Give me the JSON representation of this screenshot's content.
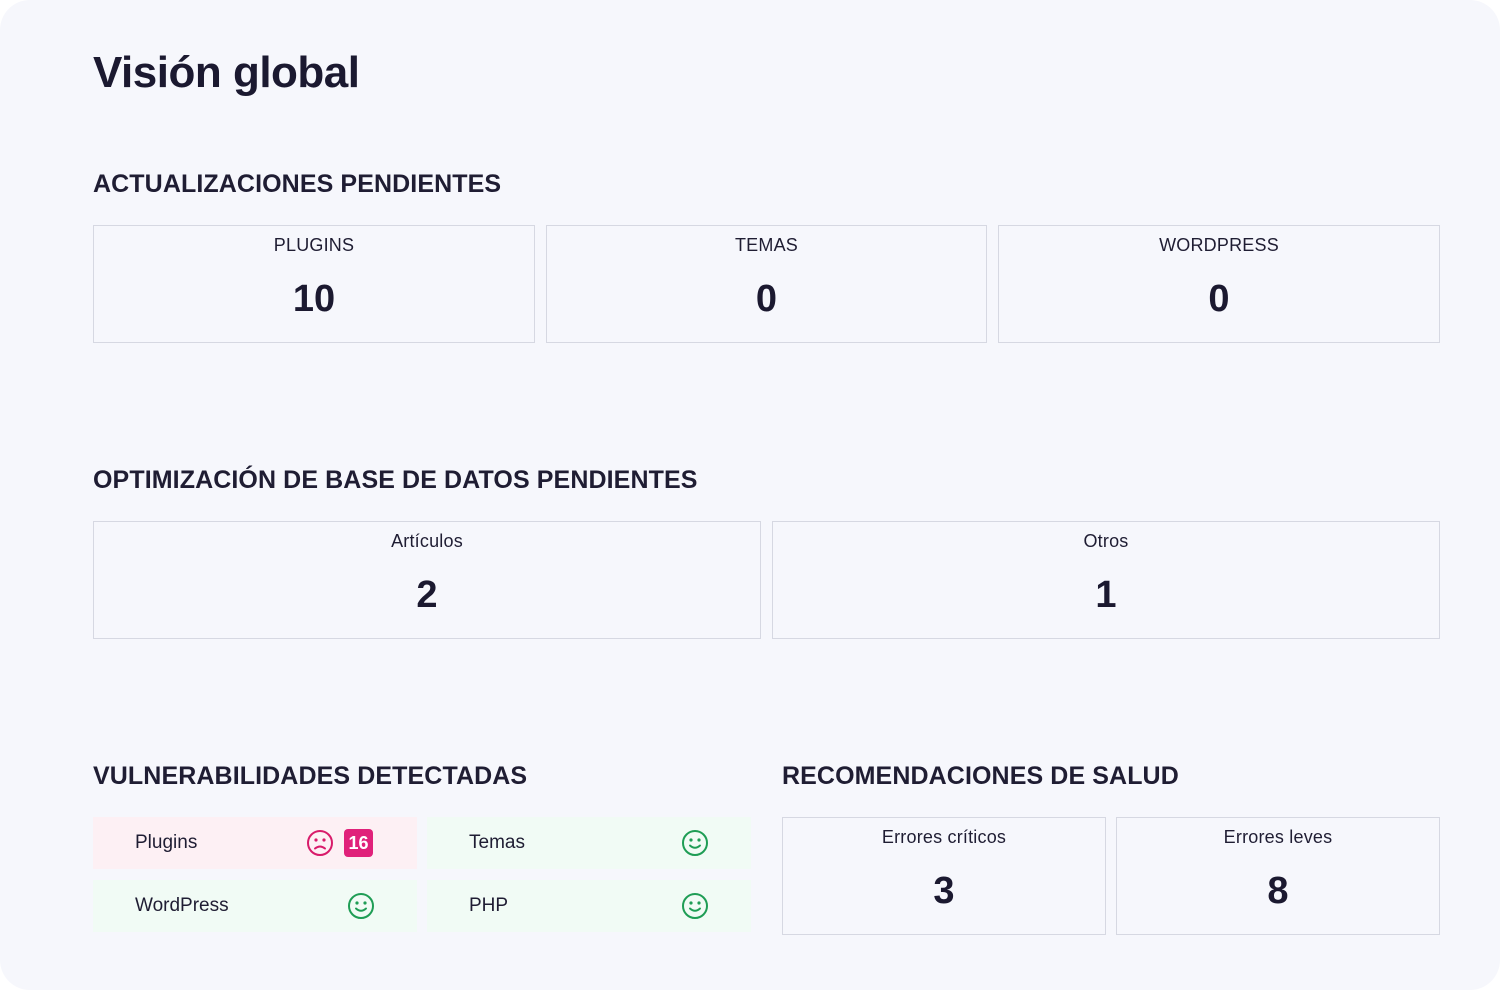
{
  "page": {
    "title": "Visión global"
  },
  "updates": {
    "title": "ACTUALIZACIONES PENDIENTES",
    "cards": [
      {
        "label": "PLUGINS",
        "value": "10"
      },
      {
        "label": "TEMAS",
        "value": "0"
      },
      {
        "label": "WORDPRESS",
        "value": "0"
      }
    ]
  },
  "db": {
    "title": "OPTIMIZACIÓN DE BASE DE DATOS PENDIENTES",
    "cards": [
      {
        "label": "Artículos",
        "value": "2"
      },
      {
        "label": "Otros",
        "value": "1"
      }
    ]
  },
  "vulns": {
    "title": "VULNERABILIDADES DETECTADAS",
    "items": [
      {
        "label": "Plugins",
        "status": "sad-face-icon",
        "count": "16",
        "color": "#e0217a"
      },
      {
        "label": "Temas",
        "status": "smile-face-icon",
        "color": "#1f9d55"
      },
      {
        "label": "WordPress",
        "status": "smile-face-icon",
        "color": "#1f9d55"
      },
      {
        "label": "PHP",
        "status": "smile-face-icon",
        "color": "#1f9d55"
      }
    ]
  },
  "health": {
    "title": "RECOMENDACIONES DE SALUD",
    "cards": [
      {
        "label": "Errores críticos",
        "value": "3"
      },
      {
        "label": "Errores leves",
        "value": "8"
      }
    ]
  }
}
